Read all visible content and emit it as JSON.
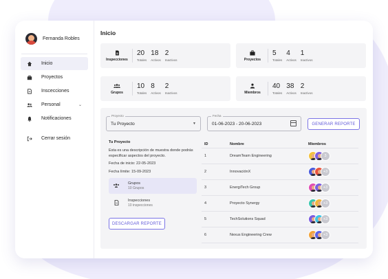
{
  "user": {
    "name": "Fernanda Robles"
  },
  "sidebar": {
    "items": [
      {
        "label": "Inicio",
        "icon": "home-icon"
      },
      {
        "label": "Proyectos",
        "icon": "briefcase-icon"
      },
      {
        "label": "Inscecciones",
        "icon": "document-icon"
      },
      {
        "label": "Personal",
        "icon": "people-icon"
      },
      {
        "label": "Notificaciones",
        "icon": "bell-icon"
      }
    ],
    "logout": "Cerrar sesión"
  },
  "page": {
    "title": "Inicio"
  },
  "stats": [
    {
      "label": "Inspecciones",
      "icon": "document-icon",
      "total": "20",
      "active": "18",
      "inactive": "2"
    },
    {
      "label": "Proyectos",
      "icon": "briefcase-icon",
      "total": "5",
      "active": "4",
      "inactive": "1"
    },
    {
      "label": "Grupos",
      "icon": "group-icon",
      "total": "10",
      "active": "8",
      "inactive": "2"
    },
    {
      "label": "Miembros",
      "icon": "person-icon",
      "total": "40",
      "active": "38",
      "inactive": "2"
    }
  ],
  "metric_labels": {
    "total": "Totales",
    "active": "Activos",
    "inactive": "Inactivos"
  },
  "filters": {
    "project_label": "Proyecto",
    "project_value": "Tu Proyecto",
    "date_label": "Fecha",
    "date_value": "01-06-2023 - 20-06-2023",
    "generate_button": "GENERAR REPORTE"
  },
  "project": {
    "title": "Tu Proyecto",
    "description": "Esta es una descripción de muestra donde podrás especificar aspectos del proyecto.",
    "start": "Fecha de inicio: 22-05-2023",
    "end": "Fecha límite: 15-09-2023",
    "groups_title": "Grupos",
    "groups_sub": "10 Grupos",
    "inspections_title": "Inspecciones",
    "inspections_sub": "10 inspecciones",
    "download_button": "DESCARGAR REPORTE"
  },
  "table": {
    "headers": {
      "id": "ID",
      "name": "Nombre",
      "members": "Miembros"
    },
    "rows": [
      {
        "id": "1",
        "name": "DreamTeam Engineering",
        "more": "3",
        "colors": [
          "#f3c23f",
          "#7e5fe0"
        ]
      },
      {
        "id": "2",
        "name": "InnovaciónX",
        "more": "+3",
        "colors": [
          "#4a5bdc",
          "#e8533e"
        ]
      },
      {
        "id": "3",
        "name": "EnergiTech Group",
        "more": "+3",
        "colors": [
          "#e04db4",
          "#7b5fe0"
        ]
      },
      {
        "id": "4",
        "name": "Proyecto Synergy",
        "more": "+3",
        "colors": [
          "#3cc7b0",
          "#f0b63d"
        ]
      },
      {
        "id": "5",
        "name": "TechSolutions Squad",
        "more": "+3",
        "colors": [
          "#7a5ce0",
          "#3fc3e6"
        ]
      },
      {
        "id": "6",
        "name": "Nexus Engineering Crew",
        "more": "+3",
        "colors": [
          "#f2a43b",
          "#5a63e8"
        ]
      }
    ]
  }
}
